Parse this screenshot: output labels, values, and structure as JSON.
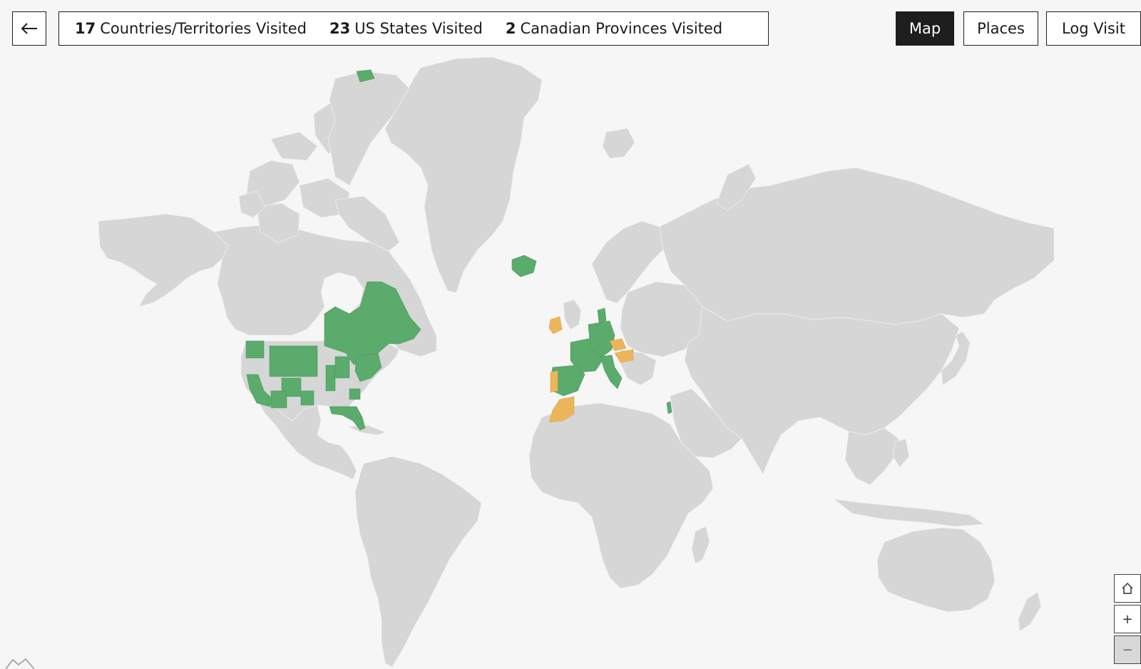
{
  "stats": {
    "countries": {
      "count": "17",
      "label": "Countries/Territories Visited"
    },
    "states": {
      "count": "23",
      "label": "US States Visited"
    },
    "provinces": {
      "count": "2",
      "label": "Canadian Provinces Visited"
    }
  },
  "nav": {
    "map_label": "Map",
    "places_label": "Places",
    "log_label": "Log Visit",
    "active": "Map"
  },
  "controls": {
    "back_icon": "arrow-left-icon",
    "home_icon": "home-icon",
    "zoom_in": "+",
    "zoom_out": "−"
  },
  "colors": {
    "background": "#f6f6f6",
    "land": "#d6d6d6",
    "visited": "#5aab6c",
    "planned": "#ecb55a",
    "border": "#1e1e1e"
  }
}
